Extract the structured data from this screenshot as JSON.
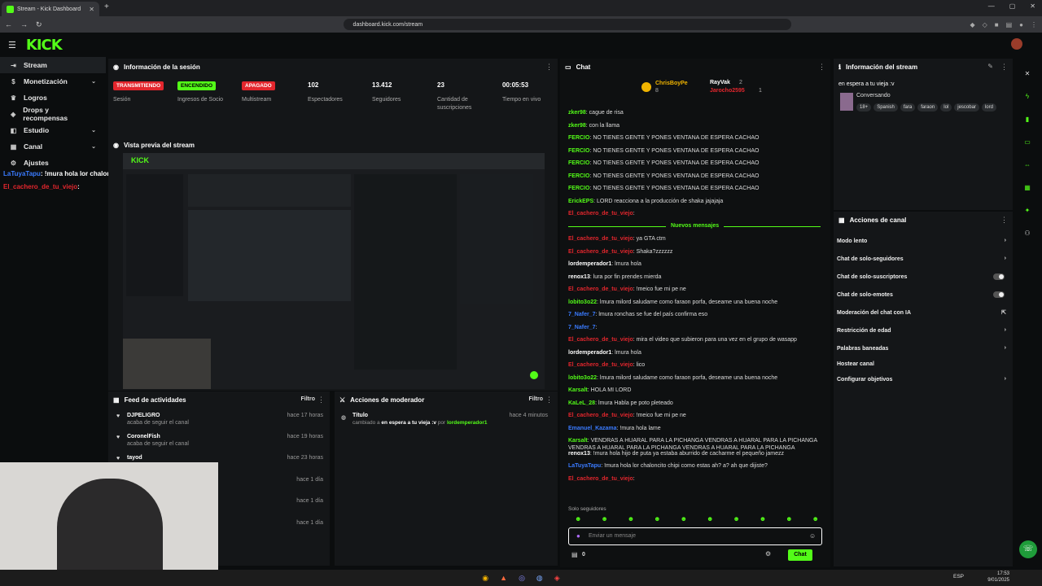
{
  "browser": {
    "tab_title": "Stream - Kick Dashboard",
    "url": "dashboard.kick.com/stream",
    "new_tab": "+",
    "win_controls": [
      "—",
      "▢",
      "✕"
    ]
  },
  "kick": {
    "logo": "KICK",
    "menu_icon": "☰"
  },
  "sidebar": {
    "items": [
      {
        "label": "Stream",
        "icon": "⇥",
        "chev": ""
      },
      {
        "label": "Monetización",
        "icon": "$",
        "chev": "⌄"
      },
      {
        "label": "Logros",
        "icon": "♛",
        "chev": ""
      },
      {
        "label": "Drops y recompensas",
        "icon": "◈",
        "chev": ""
      },
      {
        "label": "Estudio",
        "icon": "◧",
        "chev": "⌄"
      },
      {
        "label": "Canal",
        "icon": "▦",
        "chev": "⌄"
      },
      {
        "label": "Ajustes",
        "icon": "⚙",
        "chev": ""
      }
    ],
    "overlay_chat": [
      {
        "user": "LaTuyaTapu",
        "text": ": !mura hola lor chaloncito chipi como estas ah? a? ah que dijiste?"
      },
      {
        "user": "El_cachero_de_tu_viejo",
        "text": ":"
      }
    ]
  },
  "info": {
    "title": "Información de la sesión",
    "stats": [
      {
        "badge": "TRANSMITIENDO",
        "color": "#e3262d",
        "fg": "#fff",
        "label": "Sesión"
      },
      {
        "badge": "ENCENDIDO",
        "color": "#53fc18",
        "fg": "#000",
        "label": "Ingresos de Socio"
      },
      {
        "badge": "APAGADO",
        "color": "#e3262d",
        "fg": "#fff",
        "label": "Multistream"
      },
      {
        "num": "102",
        "label": "Espectadores"
      },
      {
        "num": "13.412",
        "label": "Seguidores"
      },
      {
        "num": "23",
        "label": "Cantidad de suscripciones"
      },
      {
        "num": "00:05:53",
        "label": "Tiempo en vivo"
      }
    ]
  },
  "preview": {
    "title": "Vista previa del stream",
    "thumb_logo": "KICK"
  },
  "feed": {
    "title": "Feed de actividades",
    "filter": "Filtro",
    "rows": [
      {
        "name": "DJPELIGRO",
        "sub": "acaba de seguir el canal",
        "time": "hace 17 horas"
      },
      {
        "name": "CoronelFish",
        "sub": "acaba de seguir el canal",
        "time": "hace 19 horas"
      },
      {
        "name": "tayod",
        "sub": "",
        "time": "hace 23 horas"
      },
      {
        "name": "",
        "sub": "",
        "time": "hace 1 día"
      },
      {
        "name": "",
        "sub": "",
        "time": "hace 1 día"
      },
      {
        "name": "",
        "sub": "",
        "time": "hace 1 día"
      }
    ]
  },
  "mod": {
    "title": "Acciones de moderador",
    "filter": "Filtro",
    "row": {
      "name": "Título",
      "pre": "cambiado a ",
      "value": "en espera a tu vieja :v",
      "mid": " por ",
      "by": "lordemperador1",
      "time": "hace 4 minutos"
    }
  },
  "chat": {
    "title": "Chat",
    "top": {
      "u1": "ChrisBoyPe",
      "n1": "8",
      "u2": "RayVak",
      "n2": "2",
      "u3": "Jarocho2595",
      "n3": "1"
    },
    "new_label": "Nuevos mensajes",
    "messages": [
      {
        "u": "zker98",
        "c": "#53fc18",
        "t": ": cague de risa"
      },
      {
        "u": "zker98",
        "c": "#53fc18",
        "t": ": con la llama"
      },
      {
        "u": "FERCIO",
        "c": "#53fc18",
        "t": ": NO TIENES GENTE Y PONES VENTANA DE ESPERA CACHAO"
      },
      {
        "u": "FERCIO",
        "c": "#53fc18",
        "t": ": NO TIENES GENTE Y PONES VENTANA DE ESPERA CACHAO"
      },
      {
        "u": "FERCIO",
        "c": "#53fc18",
        "t": ": NO TIENES GENTE Y PONES VENTANA DE ESPERA CACHAO"
      },
      {
        "u": "FERCIO",
        "c": "#53fc18",
        "t": ": NO TIENES GENTE Y PONES VENTANA DE ESPERA CACHAO"
      },
      {
        "u": "FERCIO",
        "c": "#53fc18",
        "t": ": NO TIENES GENTE Y PONES VENTANA DE ESPERA CACHAO"
      },
      {
        "u": "ErickEPS",
        "c": "#53fc18",
        "t": ": LORD reacciona a la producción de shaka jajajaja"
      },
      {
        "u": "El_cachero_de_tu_viejo",
        "c": "#e3262d",
        "t": ":"
      },
      {
        "u": "El_cachero_de_tu_viejo",
        "c": "#e3262d",
        "t": ": ya GTA ctm"
      },
      {
        "u": "El_cachero_de_tu_viejo",
        "c": "#e3262d",
        "t": ": Shaka?zzzzzz"
      },
      {
        "u": "lordemperador1",
        "c": "#ffffff",
        "t": ": lmura hola"
      },
      {
        "u": "renox13",
        "c": "#ffffff",
        "t": ": lura por fin prendes mierda"
      },
      {
        "u": "El_cachero_de_tu_viejo",
        "c": "#e3262d",
        "t": ": !meico fue mi pe ne"
      },
      {
        "u": "lobito3o22",
        "c": "#53fc18",
        "t": ": lmura milord saludame como faraon porfa, deseame una buena noche"
      },
      {
        "u": "7_Nafer_7",
        "c": "#3a7bff",
        "t": ": lmura ronchas se fue del país confirma eso"
      },
      {
        "u": "7_Nafer_7",
        "c": "#3a7bff",
        "t": ":"
      },
      {
        "u": "El_cachero_de_tu_viejo",
        "c": "#e3262d",
        "t": ": mira el video que subieron para una vez en el grupo de wasapp"
      },
      {
        "u": "lordemperador1",
        "c": "#ffffff",
        "t": ": lmura hola"
      },
      {
        "u": "El_cachero_de_tu_viejo",
        "c": "#e3262d",
        "t": ": lico"
      },
      {
        "u": "lobito3o22",
        "c": "#53fc18",
        "t": ": lmura milord saludame como faraon porfa, deseame una buena noche"
      },
      {
        "u": "Karsalt",
        "c": "#53fc18",
        "t": ": HOLA MI LORD"
      },
      {
        "u": "KaLeL_28",
        "c": "#53fc18",
        "t": ": lmura Habla pe poto pleteado"
      },
      {
        "u": "El_cachero_de_tu_viejo",
        "c": "#e3262d",
        "t": ": !meico fue mi pe ne"
      },
      {
        "u": "Emanuel_Kazama",
        "c": "#3a7bff",
        "t": ": !mura hola lame"
      },
      {
        "u": "Karsalt",
        "c": "#53fc18",
        "t": ": VENDRAS A HUARAL PARA LA PICHANGA  VENDRAS A HUARAL PARA LA PICHANGA  VENDRAS A HUARAL PARA LA PICHANGA  VENDRAS A HUARAL PARA LA PICHANGA"
      },
      {
        "u": "renox13",
        "c": "#ffffff",
        "t": ": !mura hola hijo de puta ya estaba aburrido de cacharme el pequeño jamezz"
      },
      {
        "u": "LaTuyaTapu",
        "c": "#3a7bff",
        "t": ": !mura hola lor chaloncito chipi como estas ah? a? ah que dijiste?"
      },
      {
        "u": "El_cachero_de_tu_viejo",
        "c": "#e3262d",
        "t": ":"
      }
    ],
    "followers_only": "Solo seguidores",
    "placeholder": "Enviar un mensaje",
    "count": "0",
    "send": "Chat"
  },
  "stream_info": {
    "title": "Información del stream",
    "stream_title": "en espera a tu vieja :v",
    "category": "Conversando",
    "tags": [
      "18+",
      "Spanish",
      "fara",
      "faraon",
      "lol",
      "jescobar",
      "lord"
    ]
  },
  "channel": {
    "title": "Acciones de canal",
    "rows": [
      {
        "label": "Modo lento",
        "ctl": "chev"
      },
      {
        "label": "Chat de solo-seguidores",
        "ctl": "chev"
      },
      {
        "label": "Chat de solo-suscriptores",
        "ctl": "toggle"
      },
      {
        "label": "Chat de solo-emotes",
        "ctl": "toggle"
      },
      {
        "label": "Moderación del chat con IA",
        "ctl": "ext"
      },
      {
        "label": "Restricción de edad",
        "ctl": "chev"
      },
      {
        "label": "Palabras baneadas",
        "ctl": "chev"
      },
      {
        "label": "Hostear canal",
        "ctl": "none"
      },
      {
        "label": "Configurar objetivos",
        "ctl": "chev"
      }
    ]
  },
  "taskbar": {
    "tray": "ESP",
    "clock": "17:53",
    "date": "9/01/2025"
  }
}
